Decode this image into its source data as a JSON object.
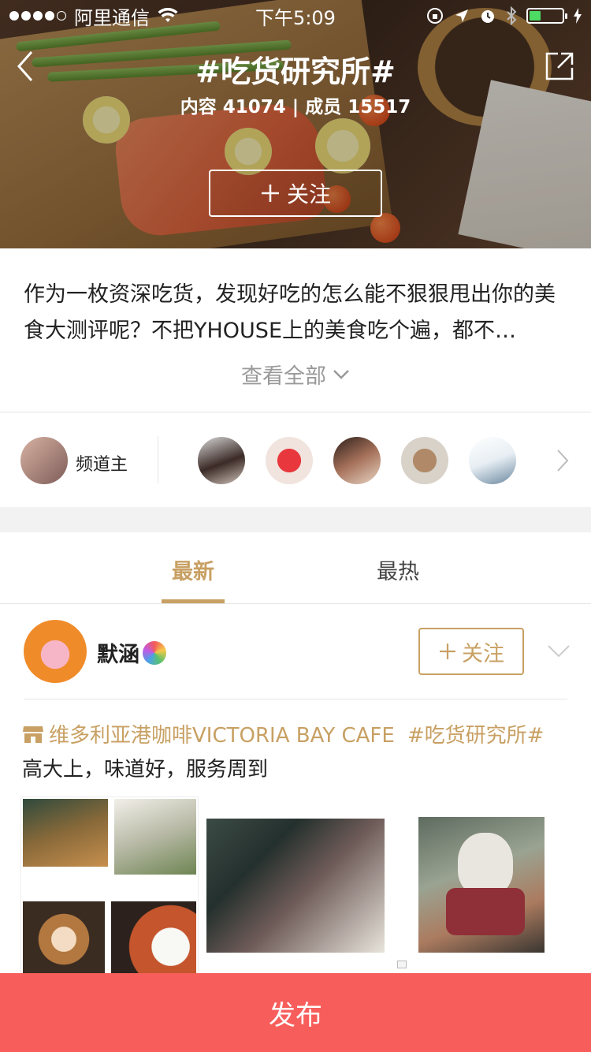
{
  "status_bar": {
    "carrier": "阿里通信",
    "time": "下午5:09",
    "signal_bars_filled": 4,
    "signal_bars_total": 5,
    "battery_level": 0.35
  },
  "header": {
    "title": "#吃货研究所#",
    "stats": "内容 41074 | 成员 15517",
    "follow_label": "关注"
  },
  "description": {
    "text": "作为一枚资深吃货，发现好吃的怎么能不狠狠甩出你的美食大测评呢？不把YHOUSE上的美食吃个遍，都不…",
    "view_all_label": "查看全部"
  },
  "members": {
    "owner_label": "频道主"
  },
  "tabs": {
    "latest": "最新",
    "hot": "最热"
  },
  "post": {
    "username": "默涵",
    "follow_label": "关注",
    "location": "维多利亚港咖啡VICTORIA BAY CAFE",
    "topic": "#吃货研究所#",
    "text": "高大上，味道好，服务周到"
  },
  "bottom_bar": {
    "publish_label": "发布"
  },
  "colors": {
    "accent": "#c8a063",
    "publish_bg": "#f75e5b",
    "divider": "#e5e5e5"
  }
}
